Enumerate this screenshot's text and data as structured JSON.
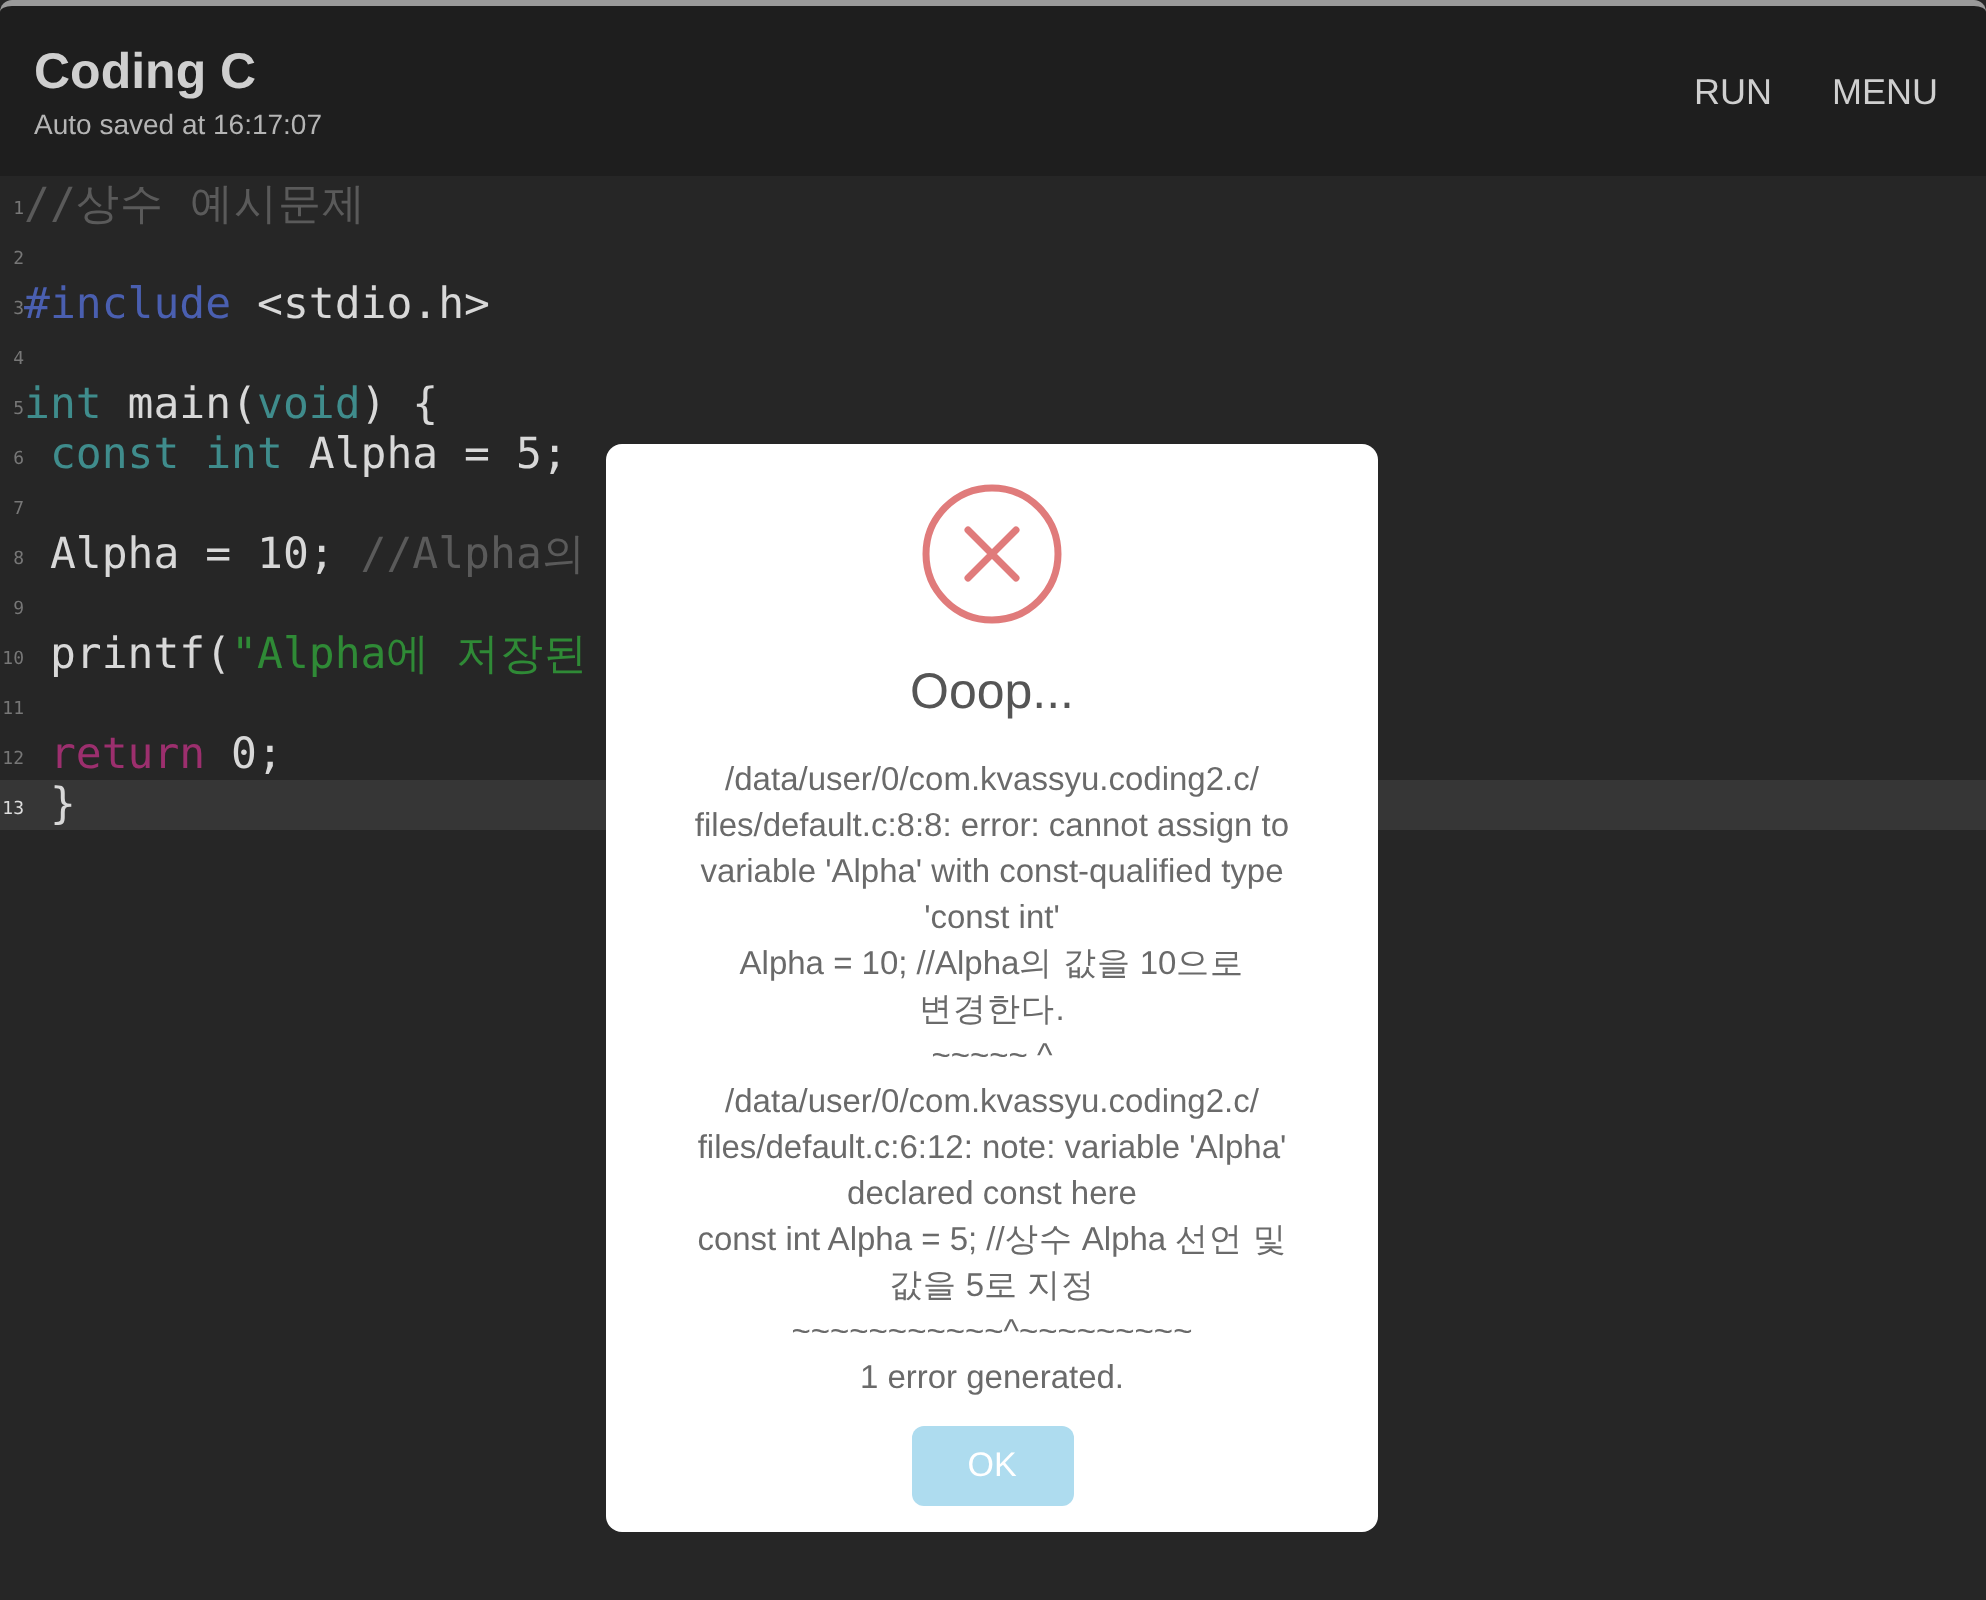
{
  "app_bar": {
    "title": "Coding C",
    "subtitle": "Auto saved at 16:17:07",
    "actions": [
      "RUN",
      "MENU"
    ]
  },
  "editor": {
    "lines": [
      {
        "number": "1",
        "selected": false,
        "tokens": [
          {
            "kind": "comment",
            "text": "//상수 예시문제"
          }
        ]
      },
      {
        "number": "2",
        "selected": false
      },
      {
        "number": "3",
        "selected": false,
        "tokens": [
          {
            "kind": "preprocessor",
            "text": "#include"
          },
          {
            "kind": "plain",
            "text": " <stdio.h>"
          }
        ]
      },
      {
        "number": "4",
        "selected": false
      },
      {
        "number": "5",
        "selected": false,
        "tokens": [
          {
            "kind": "keyword",
            "text": "int"
          },
          {
            "kind": "plain",
            "text": " main("
          },
          {
            "kind": "keyword",
            "text": "void"
          },
          {
            "kind": "plain",
            "text": ") {"
          }
        ]
      },
      {
        "number": "6",
        "selected": false,
        "tokens": [
          {
            "kind": "keyword",
            "text": " const"
          },
          {
            "kind": "keyword",
            "text": " int"
          },
          {
            "kind": "plain",
            "text": " Alpha = 5;"
          }
        ]
      },
      {
        "number": "7",
        "selected": false
      },
      {
        "number": "8",
        "selected": false,
        "tokens": [
          {
            "kind": "plain",
            "text": " Alpha = 10; "
          },
          {
            "kind": "comment",
            "text": "//Alpha의"
          }
        ]
      },
      {
        "number": "9",
        "selected": false
      },
      {
        "number": "10",
        "selected": false,
        "tokens": [
          {
            "kind": "plain",
            "text": " printf("
          },
          {
            "kind": "string",
            "text": "\"Alpha에 저장된"
          }
        ]
      },
      {
        "number": "11",
        "selected": false
      },
      {
        "number": "12",
        "selected": false,
        "tokens": [
          {
            "kind": "control",
            "text": " return"
          },
          {
            "kind": "plain",
            "text": " 0;"
          }
        ]
      },
      {
        "number": "13",
        "selected": true,
        "tokens": [
          {
            "kind": "plain",
            "text": " }"
          }
        ]
      }
    ]
  },
  "dialog": {
    "kind": "error",
    "title": "Ooop...",
    "message_lines": [
      "/data/user/0/com.kvassyu.coding2.c/",
      "files/default.c:8:8: error: cannot assign to",
      "variable 'Alpha' with const-qualified type",
      "'const int'",
      "Alpha = 10; //Alpha의 값을 10으로",
      "변경한다.",
      "~~~~~ ^",
      "/data/user/0/com.kvassyu.coding2.c/",
      "files/default.c:6:12: note: variable 'Alpha'",
      "declared const here",
      "const int Alpha = 5; //상수 Alpha 선언 및",
      "값을 5로 지정",
      "~~~~~~~~~~~^~~~~~~~~~",
      "1 error generated."
    ],
    "button": "OK"
  }
}
